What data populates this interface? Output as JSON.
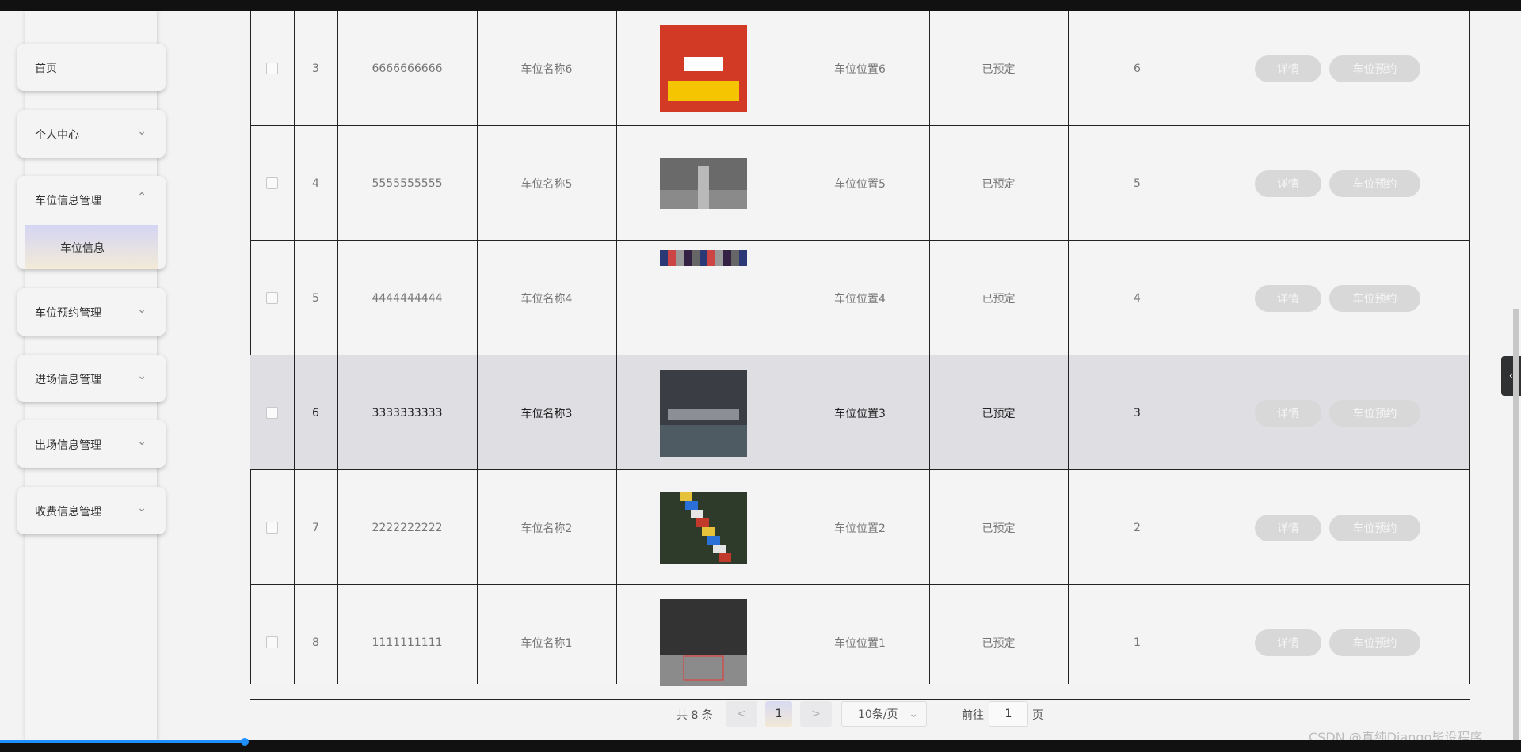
{
  "sidebar": {
    "items": [
      {
        "label": "首页",
        "chevron": ""
      },
      {
        "label": "个人中心",
        "chevron": "⌄"
      },
      {
        "label": "车位信息管理",
        "chevron": "⌃"
      },
      {
        "label": "车位预约管理",
        "chevron": "⌄"
      },
      {
        "label": "进场信息管理",
        "chevron": "⌄"
      },
      {
        "label": "出场信息管理",
        "chevron": "⌄"
      },
      {
        "label": "收费信息管理",
        "chevron": "⌄"
      }
    ],
    "submenu": {
      "label": "车位信息"
    }
  },
  "table": {
    "rows": [
      {
        "index": "3",
        "code": "6666666666",
        "name": "车位名称6",
        "location": "车位位置6",
        "status": "已预定",
        "number": "6",
        "image": "poster"
      },
      {
        "index": "4",
        "code": "5555555555",
        "name": "车位名称5",
        "location": "车位位置5",
        "status": "已预定",
        "number": "5",
        "image": "street"
      },
      {
        "index": "5",
        "code": "4444444444",
        "name": "车位名称4",
        "location": "车位位置4",
        "status": "已预定",
        "number": "4",
        "image": "broken"
      },
      {
        "index": "6",
        "code": "3333333333",
        "name": "车位名称3",
        "location": "车位位置3",
        "status": "已预定",
        "number": "3",
        "image": "garage"
      },
      {
        "index": "7",
        "code": "2222222222",
        "name": "车位名称2",
        "location": "车位位置2",
        "status": "已预定",
        "number": "2",
        "image": "aerial"
      },
      {
        "index": "8",
        "code": "1111111111",
        "name": "车位名称1",
        "location": "车位位置1",
        "status": "已预定",
        "number": "1",
        "image": "lot"
      }
    ],
    "actions": {
      "detail": "详情",
      "reserve": "车位预约"
    }
  },
  "pagination": {
    "total": "共 8 条",
    "prev": "<",
    "page": "1",
    "next": ">",
    "page_size": "10条/页",
    "goto_prefix": "前往",
    "goto_value": "1",
    "goto_suffix": "页"
  },
  "watermark": "CSDN @真纯Django毕设程序",
  "colors": {
    "accent": "#1e90ff",
    "highlight_row": "#dedee3",
    "button": "#d8d8d8"
  }
}
